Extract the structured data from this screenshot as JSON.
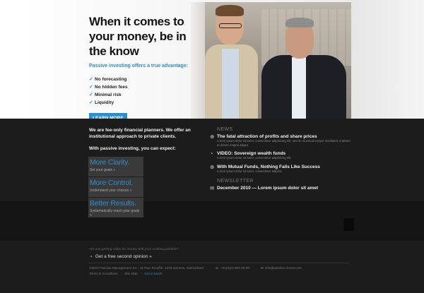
{
  "hero": {
    "title": "When it comes to your money, be in the know",
    "subtitle": "Passive investing offers a true advantage:",
    "checklist": [
      "No forecasting",
      "No hidden fees",
      "Minimal risk",
      "Liquidity"
    ],
    "cta": "LEARN MORE"
  },
  "intro": {
    "text": "We are fee-only financial planners. We offer an institutional approach to private clients.",
    "sub": "With passive investing, you can expect:"
  },
  "features": [
    {
      "title": "More Clarity.",
      "sub": "Set your goals »"
    },
    {
      "title": "More Control.",
      "sub": "Understand your choices »"
    },
    {
      "title": "Better Results.",
      "sub": "Systematically reach your goals »"
    }
  ],
  "news": {
    "heading": "NEWS",
    "items": [
      {
        "icon": "globe-icon",
        "title": "The fatal attraction of profits and share prices",
        "desc": "Lorem ipsum dolor sit amet, consectetur adipisicing elit, sed do eiusmod tempor incididunt ut labore et dolore magna aliqua."
      },
      {
        "icon": "speech-bubble-icon",
        "title": "VIDEO: Sovereign wealth funds",
        "desc": "Lorem ipsum dolor sit amet, consectetur adipisicing elit."
      },
      {
        "icon": "globe-icon",
        "title": "With Mutual Funds, Nothing Fails Like Success",
        "desc": "Lorem ipsum dolor sit amet, consectetur adipisic"
      }
    ]
  },
  "newsletter": {
    "heading": "NEWSLETTER",
    "item": "December 2010 — Lorem ipsum dolor sit amet"
  },
  "footer": {
    "question": "Are you getting value for money with your existing portfolio?",
    "opinion": "Get a free second opinion »",
    "address": "©2010 Passive Management SA · 15 Rue Tonoffin, 1206 Geneva, Switzerland",
    "phone": "+41(0)22 800 00 99",
    "email": "info@passive-invest.com",
    "links": [
      "Terms & Conditions",
      "Site Map",
      "Get in touch"
    ]
  }
}
